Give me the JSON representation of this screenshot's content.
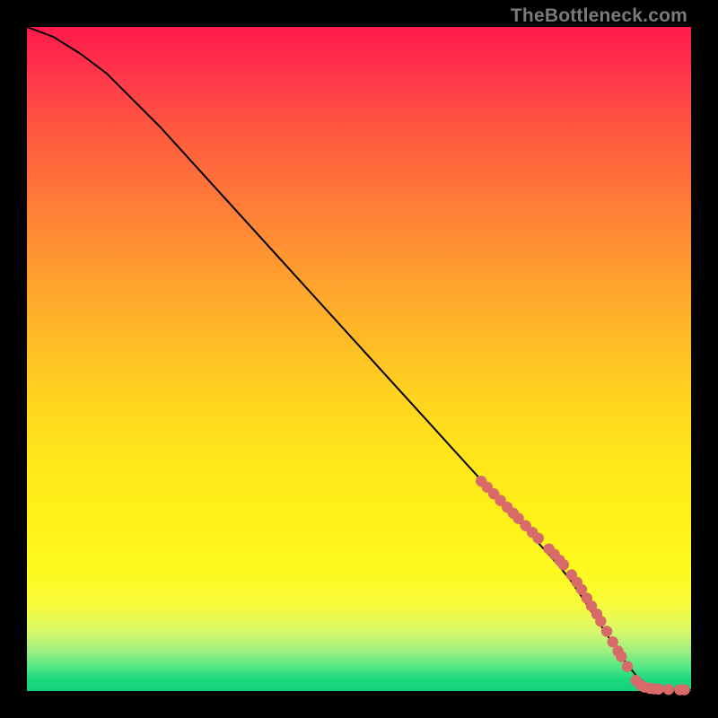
{
  "watermark_text": "TheBottleneck.com",
  "colors": {
    "marker_fill": "#d86a6a",
    "marker_stroke": "#c05a5a",
    "curve_stroke": "#000000"
  },
  "chart_data": {
    "type": "line",
    "title": "",
    "xlabel": "",
    "ylabel": "",
    "xlim": [
      0,
      100
    ],
    "ylim": [
      0,
      100
    ],
    "curve": {
      "x": [
        0,
        4,
        8,
        12,
        16,
        20,
        25,
        30,
        35,
        40,
        45,
        50,
        55,
        60,
        65,
        70,
        75,
        80,
        82,
        84,
        86,
        88,
        90,
        92,
        94,
        96,
        98,
        100
      ],
      "y": [
        100,
        98.5,
        96,
        93,
        89,
        85,
        79.5,
        74,
        68.5,
        63,
        57.5,
        52,
        46.5,
        41,
        35.5,
        30,
        24.5,
        19,
        16.5,
        13.5,
        10.5,
        7.5,
        4.5,
        2.0,
        0.6,
        0.3,
        0.2,
        0.2
      ]
    },
    "markers": [
      {
        "x": 68.4,
        "y": 31.6
      },
      {
        "x": 69.3,
        "y": 30.7
      },
      {
        "x": 70.3,
        "y": 29.7
      },
      {
        "x": 71.3,
        "y": 28.7
      },
      {
        "x": 72.3,
        "y": 27.7
      },
      {
        "x": 73.2,
        "y": 26.8
      },
      {
        "x": 74.0,
        "y": 26.0
      },
      {
        "x": 75.1,
        "y": 24.9
      },
      {
        "x": 76.1,
        "y": 23.9
      },
      {
        "x": 77.0,
        "y": 23.0
      },
      {
        "x": 78.6,
        "y": 21.4
      },
      {
        "x": 79.4,
        "y": 20.6
      },
      {
        "x": 80.2,
        "y": 19.7
      },
      {
        "x": 80.8,
        "y": 19.0
      },
      {
        "x": 82.0,
        "y": 17.5
      },
      {
        "x": 82.8,
        "y": 16.4
      },
      {
        "x": 83.5,
        "y": 15.3
      },
      {
        "x": 84.3,
        "y": 14.0
      },
      {
        "x": 85.0,
        "y": 12.8
      },
      {
        "x": 85.8,
        "y": 11.6
      },
      {
        "x": 86.4,
        "y": 10.5
      },
      {
        "x": 87.3,
        "y": 9.0
      },
      {
        "x": 88.2,
        "y": 7.4
      },
      {
        "x": 89.0,
        "y": 6.0
      },
      {
        "x": 89.5,
        "y": 5.2
      },
      {
        "x": 90.4,
        "y": 3.7
      },
      {
        "x": 91.7,
        "y": 1.6
      },
      {
        "x": 92.4,
        "y": 0.9
      },
      {
        "x": 93.0,
        "y": 0.6
      },
      {
        "x": 93.8,
        "y": 0.4
      },
      {
        "x": 94.4,
        "y": 0.35
      },
      {
        "x": 95.1,
        "y": 0.3
      },
      {
        "x": 96.6,
        "y": 0.25
      },
      {
        "x": 98.3,
        "y": 0.2
      },
      {
        "x": 99.0,
        "y": 0.2
      }
    ]
  }
}
